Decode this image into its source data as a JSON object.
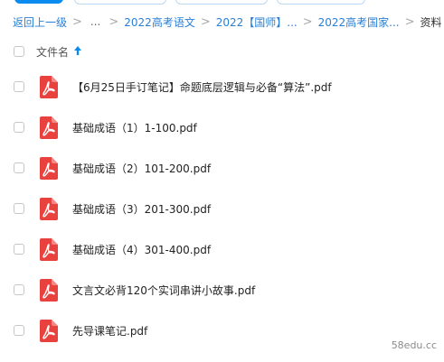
{
  "breadcrumb": {
    "back_label": "返回上一级",
    "ellipsis": "...",
    "items": [
      {
        "label": "2022高考语文"
      },
      {
        "label": "2022【国师】..."
      },
      {
        "label": "2022高考国家..."
      }
    ],
    "current": "资料",
    "separator": ">"
  },
  "list_header": {
    "name_column": "文件名",
    "sort": "ascending"
  },
  "files": [
    {
      "name": "【6月25日手订笔记】命题底层逻辑与必备“算法”.pdf",
      "icon": "pdf-icon"
    },
    {
      "name": "基础成语（1）1-100.pdf",
      "icon": "pdf-icon"
    },
    {
      "name": "基础成语（2）101-200.pdf",
      "icon": "pdf-icon"
    },
    {
      "name": "基础成语（3）201-300.pdf",
      "icon": "pdf-icon"
    },
    {
      "name": "基础成语（4）301-400.pdf",
      "icon": "pdf-icon"
    },
    {
      "name": "文言文必背120个实词串讲小故事.pdf",
      "icon": "pdf-icon"
    },
    {
      "name": "先导课笔记.pdf",
      "icon": "pdf-icon"
    }
  ],
  "watermark": "58edu.cc",
  "colors": {
    "accent": "#0a8bf0",
    "link": "#2a7fd6",
    "pdf_red": "#e8413e"
  }
}
